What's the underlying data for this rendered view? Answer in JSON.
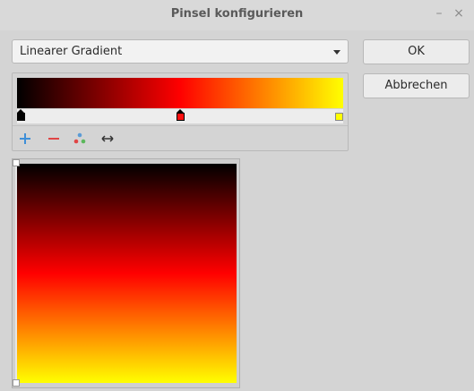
{
  "window": {
    "title": "Pinsel konfigurieren",
    "minimize_glyph": "–",
    "close_glyph": "×"
  },
  "brush_type": {
    "selected": "Linearer Gradient"
  },
  "buttons": {
    "ok": "OK",
    "cancel": "Abbrechen"
  },
  "gradient": {
    "colors": [
      "#000000",
      "#ff0000",
      "#ffff00"
    ],
    "stops": [
      {
        "color": "#000000",
        "position": 0.0
      },
      {
        "color": "#ff0000",
        "position": 0.5
      },
      {
        "color": "#ffff00",
        "position": 1.0
      }
    ]
  },
  "toolbar": {
    "icons": [
      "add-stop-icon",
      "remove-stop-icon",
      "colors-icon",
      "flip-gradient-icon"
    ]
  },
  "preview": {
    "direction": "vertical"
  }
}
